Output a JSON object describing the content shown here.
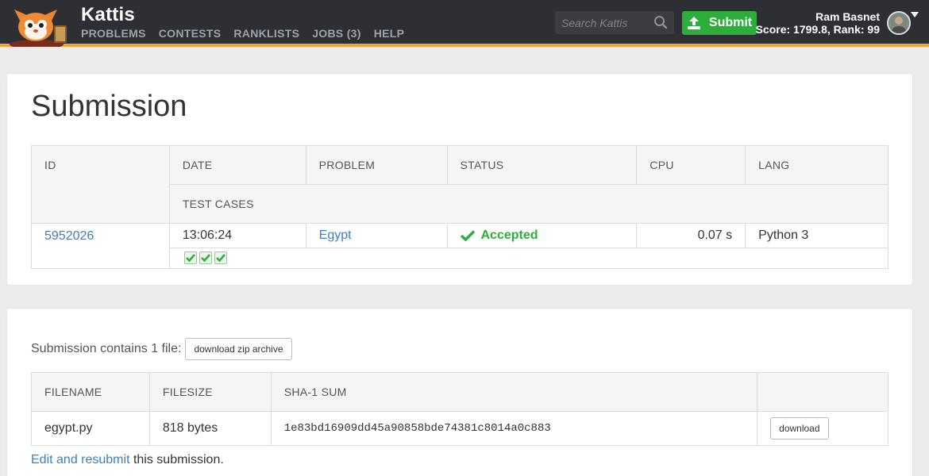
{
  "header": {
    "brand": "Kattis",
    "nav": [
      "PROBLEMS",
      "CONTESTS",
      "RANKLISTS",
      "JOBS (3)",
      "HELP"
    ],
    "search_placeholder": "Search Kattis",
    "submit_label": "Submit",
    "user_name": "Ram Basnet",
    "user_stats": "Score: 1799.8, Rank: 99",
    "accent_color": "#f0a336",
    "submit_color": "#2dae3c"
  },
  "submission": {
    "title": "Submission",
    "columns": {
      "id": "ID",
      "date": "DATE",
      "problem": "PROBLEM",
      "status": "STATUS",
      "cpu": "CPU",
      "lang": "LANG",
      "test_cases": "TEST CASES"
    },
    "row": {
      "id": "5952026",
      "date": "13:06:24",
      "problem": "Egypt",
      "status": "Accepted",
      "cpu": "0.07 s",
      "lang": "Python 3",
      "test_cases_passed": 3
    }
  },
  "files": {
    "intro": "Submission contains 1 file:",
    "download_zip_label": "download zip archive",
    "columns": {
      "filename": "FILENAME",
      "filesize": "FILESIZE",
      "sha1": "SHA-1 SUM"
    },
    "rows": [
      {
        "filename": "egypt.py",
        "filesize": "818 bytes",
        "sha1": "1e83bd16909dd45a90858bde74381c8014a0c883",
        "download_label": "download"
      }
    ],
    "edit_link": "Edit and resubmit",
    "edit_suffix": " this submission."
  }
}
